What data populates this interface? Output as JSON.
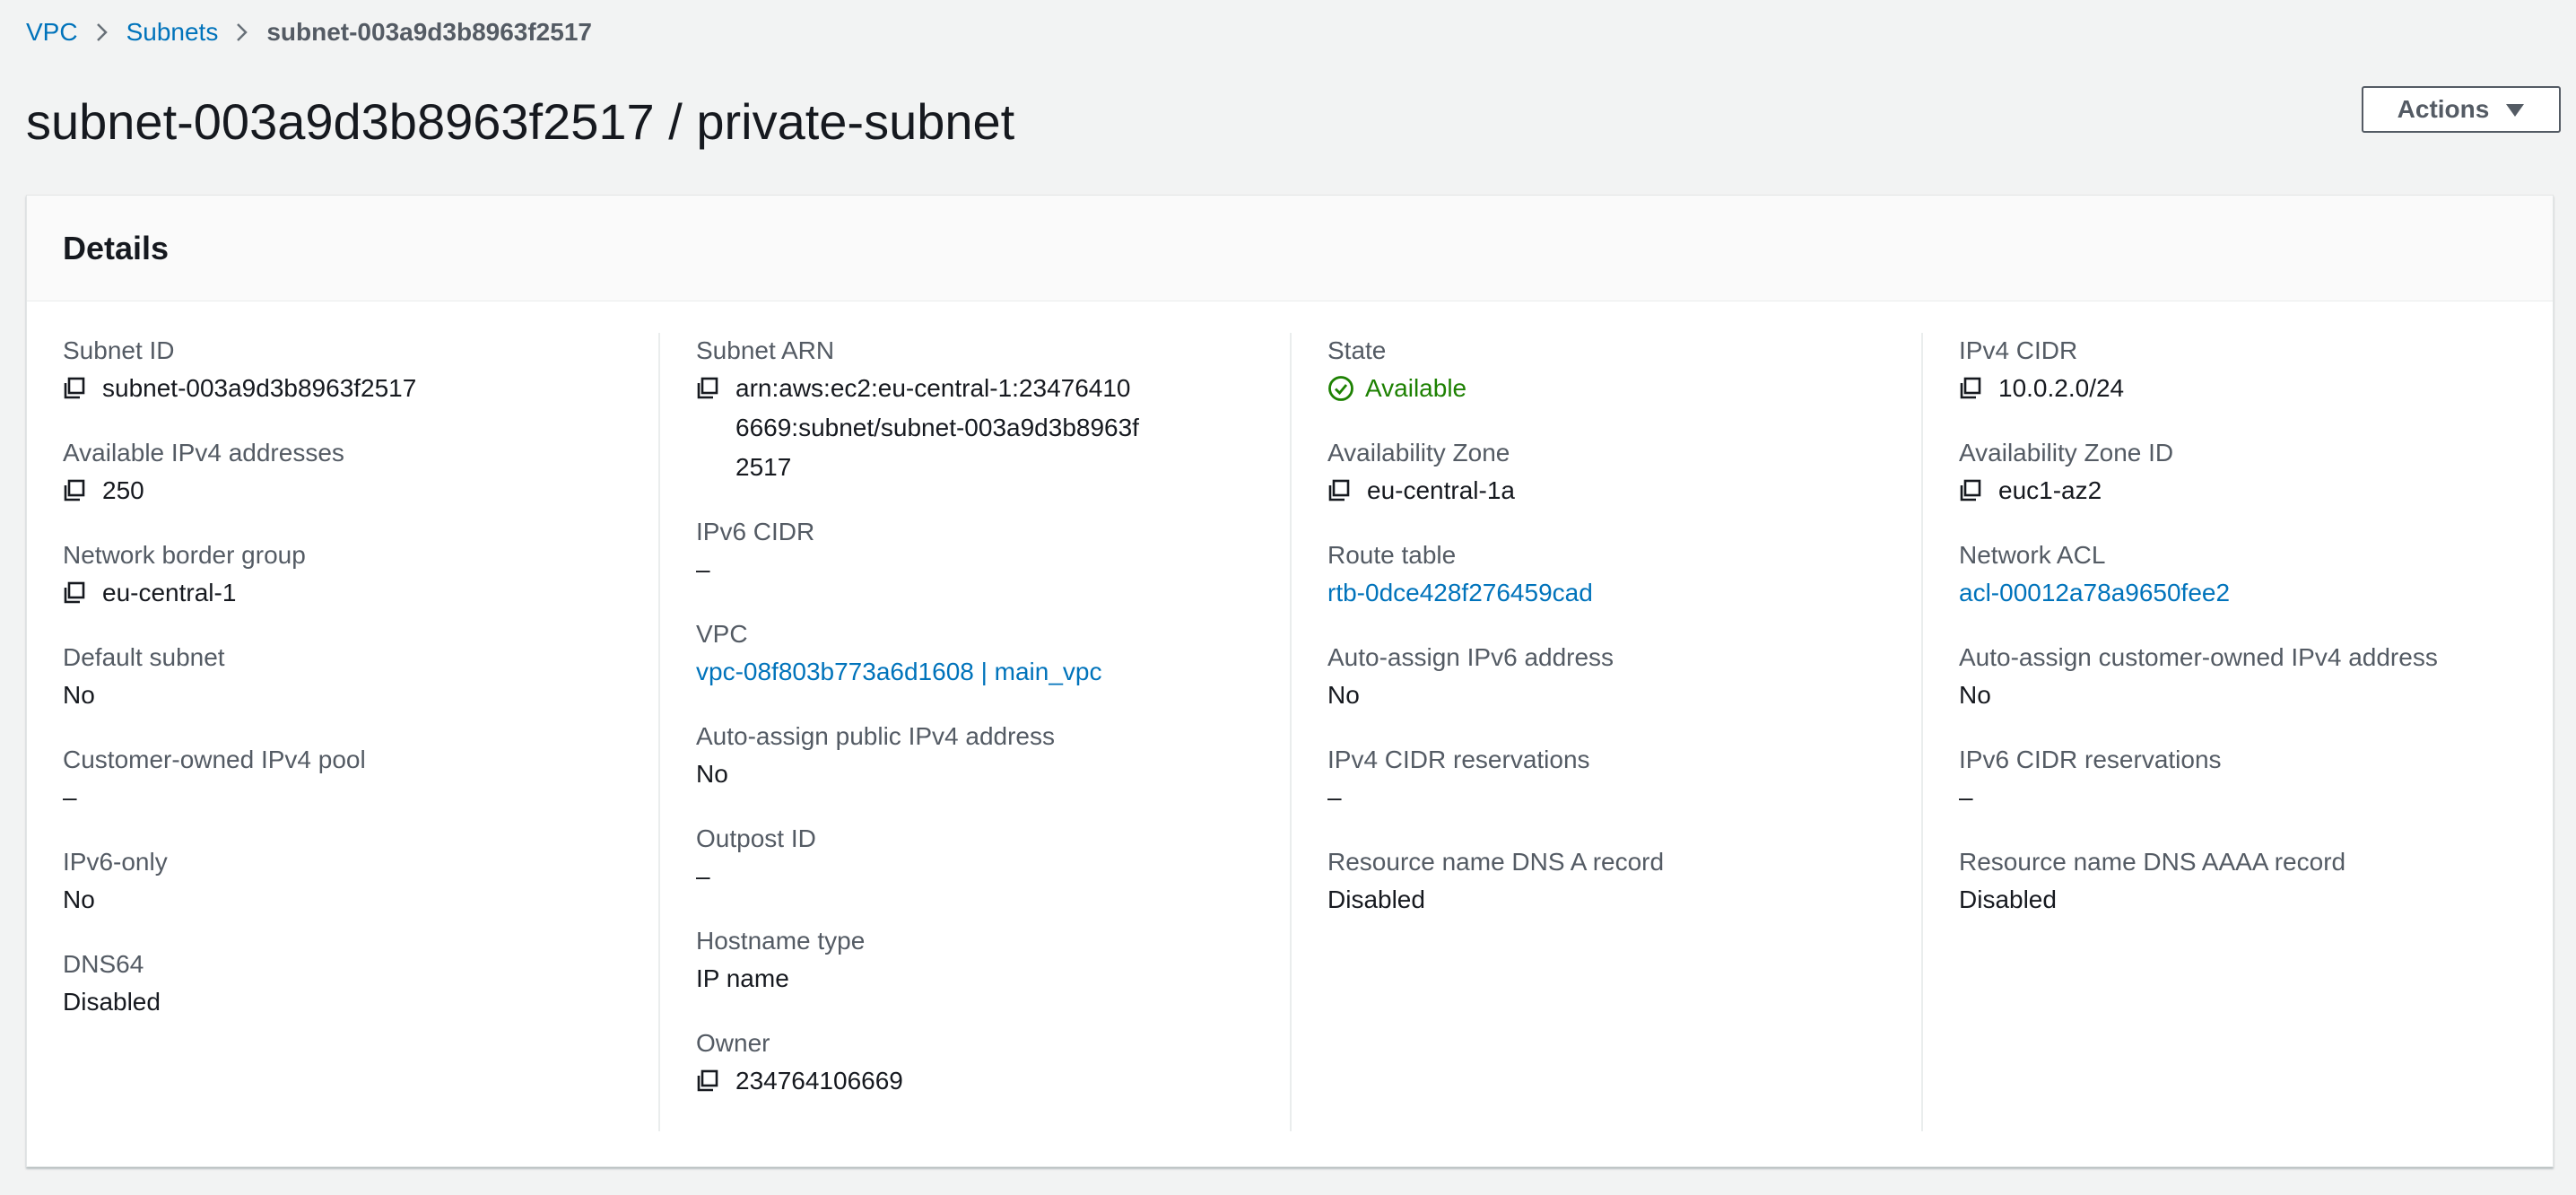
{
  "breadcrumb": {
    "items": [
      "VPC",
      "Subnets"
    ],
    "current": "subnet-003a9d3b8963f2517"
  },
  "page": {
    "title": "subnet-003a9d3b8963f2517 / private-subnet",
    "actions_label": "Actions"
  },
  "panel": {
    "title": "Details"
  },
  "fields": {
    "subnet_id": {
      "label": "Subnet ID",
      "value": "subnet-003a9d3b8963f2517"
    },
    "available_ipv4": {
      "label": "Available IPv4 addresses",
      "value": "250"
    },
    "network_border_group": {
      "label": "Network border group",
      "value": "eu-central-1"
    },
    "default_subnet": {
      "label": "Default subnet",
      "value": "No"
    },
    "customer_owned_pool": {
      "label": "Customer-owned IPv4 pool",
      "value": "–"
    },
    "ipv6_only": {
      "label": "IPv6-only",
      "value": "No"
    },
    "dns64": {
      "label": "DNS64",
      "value": "Disabled"
    },
    "subnet_arn": {
      "label": "Subnet ARN",
      "value": "arn:aws:ec2:eu-central-1:234764106669:subnet/subnet-003a9d3b8963f2517"
    },
    "ipv6_cidr": {
      "label": "IPv6 CIDR",
      "value": "–"
    },
    "vpc": {
      "label": "VPC",
      "value": "vpc-08f803b773a6d1608 | main_vpc"
    },
    "auto_assign_public_ipv4": {
      "label": "Auto-assign public IPv4 address",
      "value": "No"
    },
    "outpost_id": {
      "label": "Outpost ID",
      "value": "–"
    },
    "hostname_type": {
      "label": "Hostname type",
      "value": "IP name"
    },
    "owner": {
      "label": "Owner",
      "value": "234764106669"
    },
    "state": {
      "label": "State",
      "value": "Available"
    },
    "availability_zone": {
      "label": "Availability Zone",
      "value": "eu-central-1a"
    },
    "route_table": {
      "label": "Route table",
      "value": "rtb-0dce428f276459cad"
    },
    "auto_assign_ipv6": {
      "label": "Auto-assign IPv6 address",
      "value": "No"
    },
    "ipv4_cidr_reservations": {
      "label": "IPv4 CIDR reservations",
      "value": "–"
    },
    "dns_a_record": {
      "label": "Resource name DNS A record",
      "value": "Disabled"
    },
    "ipv4_cidr": {
      "label": "IPv4 CIDR",
      "value": "10.0.2.0/24"
    },
    "availability_zone_id": {
      "label": "Availability Zone ID",
      "value": "euc1-az2"
    },
    "network_acl": {
      "label": "Network ACL",
      "value": "acl-00012a78a9650fee2"
    },
    "auto_assign_customer_owned": {
      "label": "Auto-assign customer-owned IPv4 address",
      "value": "No"
    },
    "ipv6_cidr_reservations": {
      "label": "IPv6 CIDR reservations",
      "value": "–"
    },
    "dns_aaaa_record": {
      "label": "Resource name DNS AAAA record",
      "value": "Disabled"
    }
  },
  "icons": {
    "copy": "copy-icon",
    "status": "check-circle-icon",
    "breadcrumb_separator": "chevron-right-icon",
    "dropdown": "caret-down-icon"
  },
  "colors": {
    "link": "#0073bb",
    "status_ok": "#1d8102",
    "label": "#545b64",
    "text": "#16191f",
    "background": "#f2f3f3"
  }
}
